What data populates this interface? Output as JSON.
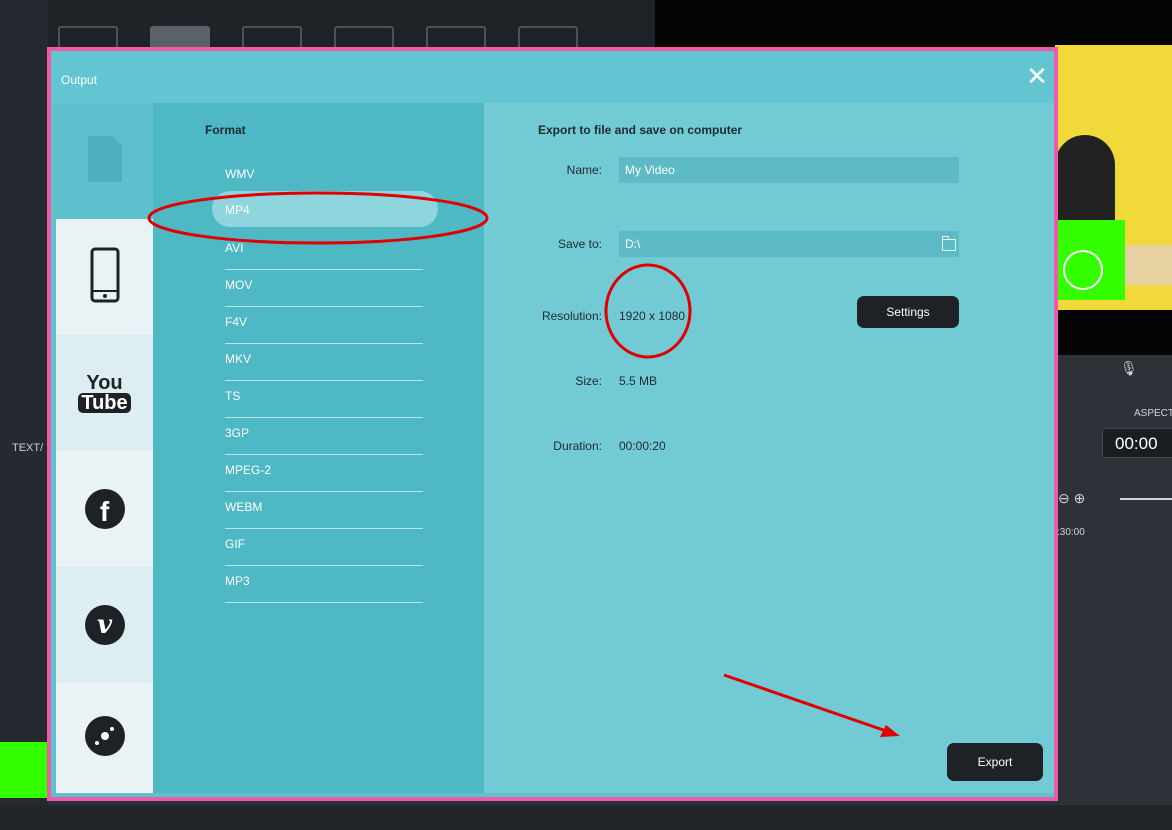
{
  "background": {
    "text_label": "TEXT/",
    "aspect_label": "ASPECT",
    "timecode": "00:00",
    "ruler_time": ":30:00"
  },
  "dialog": {
    "title": "Output",
    "close_glyph": "✕",
    "sidebar": {
      "items": [
        {
          "icon": "file-icon"
        },
        {
          "icon": "phone-icon"
        },
        {
          "icon": "youtube-icon",
          "text_top": "You",
          "text_bottom": "Tube"
        },
        {
          "icon": "facebook-icon",
          "glyph": "f"
        },
        {
          "icon": "vimeo-icon",
          "glyph": "v"
        },
        {
          "icon": "disc-icon"
        }
      ]
    },
    "format": {
      "heading": "Format",
      "items": [
        "WMV",
        "MP4",
        "AVI",
        "MOV",
        "F4V",
        "MKV",
        "TS",
        "3GP",
        "MPEG-2",
        "WEBM",
        "GIF",
        "MP3"
      ],
      "selected": "MP4"
    },
    "export": {
      "heading": "Export to file and save on computer",
      "name_label": "Name:",
      "name_value": "My Video",
      "saveto_label": "Save to:",
      "saveto_value": "D:\\",
      "resolution_label": "Resolution:",
      "resolution_value": "1920 x 1080",
      "settings_button": "Settings",
      "size_label": "Size:",
      "size_value": "5.5 MB",
      "duration_label": "Duration:",
      "duration_value": "00:00:20",
      "export_button": "Export"
    }
  },
  "colors": {
    "border": "#ef5aa8",
    "annotation": "#e00000",
    "dialog_bg": "#5ec2ce",
    "button_dark": "#1e2126"
  }
}
